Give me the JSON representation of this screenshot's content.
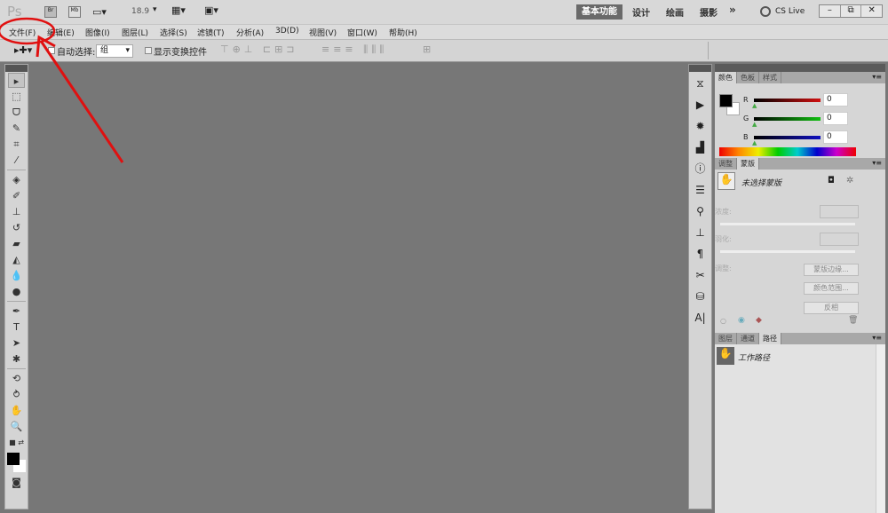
{
  "app": {
    "logo": "Ps",
    "zoom": "18.9",
    "bridge": "Br",
    "minibridge": "Mb"
  },
  "workspaces": {
    "active": "基本功能",
    "items": [
      "设计",
      "绘画",
      "摄影"
    ],
    "more": "»",
    "cslive": "CS Live"
  },
  "menu": [
    "文件(F)",
    "编辑(E)",
    "图像(I)",
    "图层(L)",
    "选择(S)",
    "滤镜(T)",
    "分析(A)",
    "3D(D)",
    "视图(V)",
    "窗口(W)",
    "帮助(H)"
  ],
  "options": {
    "auto_select_label": "自动选择:",
    "auto_select_value": "组",
    "show_transform": "显示变换控件"
  },
  "color_panel": {
    "tabs": [
      "颜色",
      "色板",
      "样式"
    ],
    "channels": [
      {
        "label": "R",
        "value": "0",
        "color": "#d01010"
      },
      {
        "label": "G",
        "value": "0",
        "color": "#10c010"
      },
      {
        "label": "B",
        "value": "0",
        "color": "#1010c0"
      }
    ]
  },
  "masks_panel": {
    "tabs": [
      "调整",
      "蒙版"
    ],
    "title": "未选择蒙版",
    "density": "浓度:",
    "feather": "羽化:",
    "refine": "调整:",
    "mask_edge": "蒙版边缘...",
    "color_range": "颜色范围...",
    "invert": "反相"
  },
  "paths_panel": {
    "tabs": [
      "图层",
      "通道",
      "路径"
    ],
    "item": "工作路径"
  },
  "annotation_color": "#e01010"
}
